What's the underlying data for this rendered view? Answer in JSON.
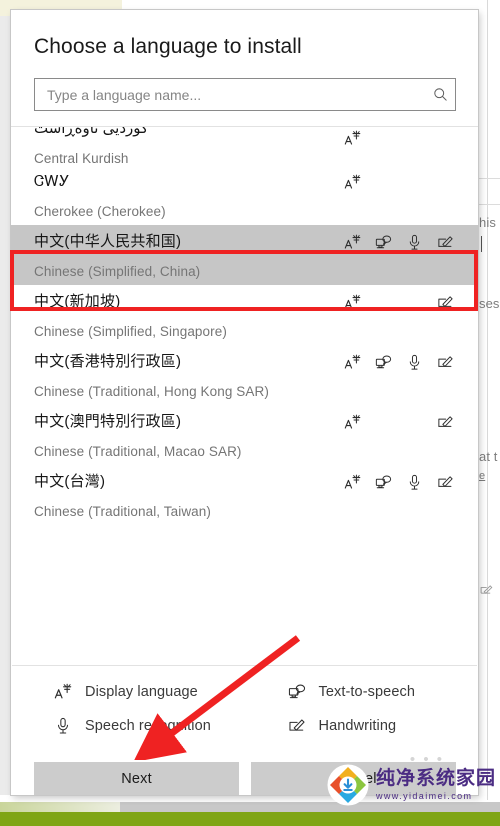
{
  "dialog": {
    "title": "Choose a language to install",
    "search": {
      "placeholder": "Type a language name...",
      "value": "",
      "icon": "search-icon"
    },
    "languages": [
      {
        "native": "کوردیی ناوەڕاست",
        "english": "Central Kurdish",
        "features": [
          "display-language"
        ],
        "selected": false,
        "clipped": true
      },
      {
        "native": "ᏣᎳᎩ",
        "english": "Cherokee (Cherokee)",
        "features": [
          "display-language"
        ],
        "selected": false,
        "clipped": false
      },
      {
        "native": "中文(中华人民共和国)",
        "english": "Chinese (Simplified, China)",
        "features": [
          "display-language",
          "text-to-speech",
          "speech-recognition",
          "handwriting"
        ],
        "selected": true,
        "clipped": false
      },
      {
        "native": "中文(新加坡)",
        "english": "Chinese (Simplified, Singapore)",
        "features": [
          "display-language",
          "handwriting"
        ],
        "selected": false,
        "clipped": false
      },
      {
        "native": "中文(香港特別行政區)",
        "english": "Chinese (Traditional, Hong Kong SAR)",
        "features": [
          "display-language",
          "text-to-speech",
          "speech-recognition",
          "handwriting"
        ],
        "selected": false,
        "clipped": false
      },
      {
        "native": "中文(澳門特別行政區)",
        "english": "Chinese (Traditional, Macao SAR)",
        "features": [
          "display-language",
          "handwriting"
        ],
        "selected": false,
        "clipped": false
      },
      {
        "native": "中文(台灣)",
        "english": "Chinese (Traditional, Taiwan)",
        "features": [
          "display-language",
          "text-to-speech",
          "speech-recognition",
          "handwriting"
        ],
        "selected": false,
        "clipped": false
      }
    ],
    "legend": [
      {
        "icon": "display-language",
        "label": "Display language"
      },
      {
        "icon": "text-to-speech",
        "label": "Text-to-speech"
      },
      {
        "icon": "speech-recognition",
        "label": "Speech recognition"
      },
      {
        "icon": "handwriting",
        "label": "Handwriting"
      }
    ],
    "buttons": {
      "next": "Next",
      "cancel": "Cancel"
    }
  },
  "background": {
    "fragment_1": "his",
    "fragment_2": "ses",
    "fragment_3": "at t",
    "fragment_4": "e"
  },
  "annotations": {
    "highlight_color": "#ef2222",
    "arrow_color": "#ef2222",
    "highlight_target": "中文(中华人民共和国)",
    "arrow_target": "Next"
  },
  "watermark": {
    "name": "纯净系统家园",
    "url": "www.yidaimei.com",
    "dots": "• • •"
  },
  "colors": {
    "selection": "#c6c6c6",
    "button": "#cccccc",
    "accent_red": "#ef2222",
    "bottom_bar": "#7fa515"
  }
}
